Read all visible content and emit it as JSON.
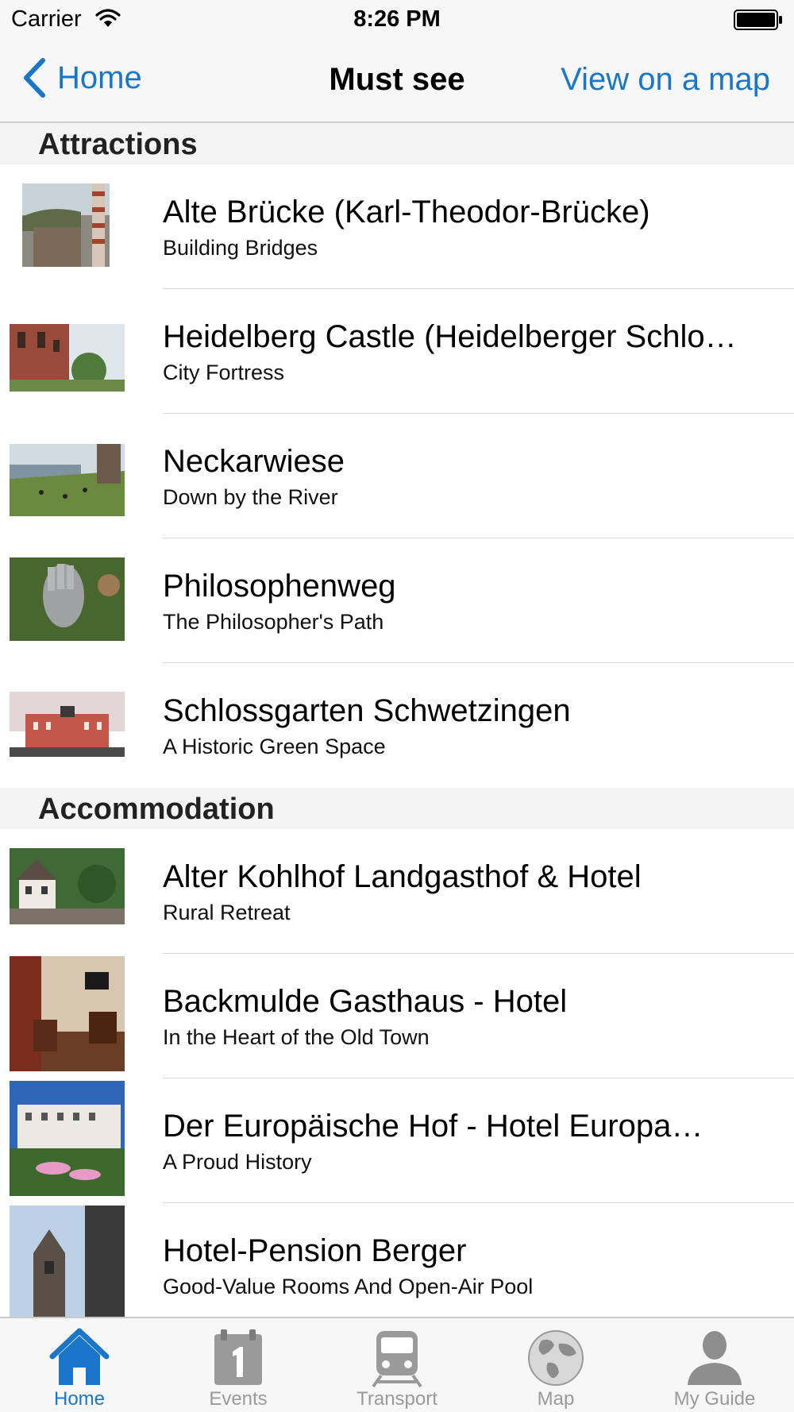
{
  "status_bar": {
    "carrier": "Carrier",
    "time": "8:26 PM"
  },
  "nav": {
    "back_label": "Home",
    "title": "Must see",
    "map_link": "View on a map"
  },
  "sections": [
    {
      "header": "Attractions",
      "items": [
        {
          "title": "Alte Brücke (Karl-Theodor-Brücke)",
          "subtitle": "Building Bridges"
        },
        {
          "title": "Heidelberg Castle (Heidelberger Schlo…",
          "subtitle": "City Fortress"
        },
        {
          "title": "Neckarwiese",
          "subtitle": "Down by the River"
        },
        {
          "title": "Philosophenweg",
          "subtitle": "The Philosopher's Path"
        },
        {
          "title": "Schlossgarten Schwetzingen",
          "subtitle": "A Historic Green Space"
        }
      ]
    },
    {
      "header": "Accommodation",
      "items": [
        {
          "title": "Alter Kohlhof Landgasthof & Hotel",
          "subtitle": "Rural Retreat"
        },
        {
          "title": "Backmulde Gasthaus - Hotel",
          "subtitle": "In the Heart of the Old Town"
        },
        {
          "title": "Der Europäische Hof - Hotel Europa…",
          "subtitle": "A Proud History"
        },
        {
          "title": "Hotel-Pension Berger",
          "subtitle": "Good-Value Rooms And Open-Air Pool"
        }
      ]
    }
  ],
  "tabs": [
    {
      "label": "Home",
      "icon": "home-icon",
      "active": true
    },
    {
      "label": "Events",
      "icon": "calendar-icon",
      "active": false
    },
    {
      "label": "Transport",
      "icon": "train-icon",
      "active": false
    },
    {
      "label": "Map",
      "icon": "globe-icon",
      "active": false
    },
    {
      "label": "My Guide",
      "icon": "person-icon",
      "active": false
    }
  ],
  "colors": {
    "accent": "#1a76c9",
    "inactive": "#9a9a9a",
    "bar_bg": "#f7f7f7"
  }
}
